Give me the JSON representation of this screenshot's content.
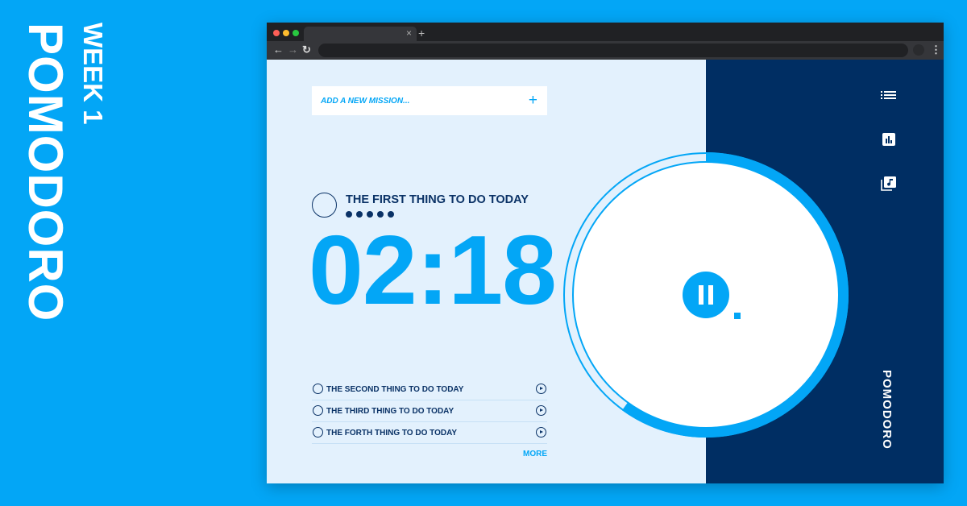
{
  "poster": {
    "week": "WEEK 1",
    "title": "POMODORO",
    "background": "#03a6f6"
  },
  "browser": {
    "tab_close": "×",
    "new_tab": "+",
    "back": "←",
    "forward": "→",
    "reload": "↻",
    "menu": "⋮"
  },
  "app": {
    "add_placeholder": "ADD A NEW MISSION...",
    "add_icon": "+",
    "current": {
      "title": "THE FIRST THING TO DO TODAY",
      "pomodoros": 5
    },
    "timer": "02:18",
    "progress": 0.6,
    "tasks": [
      {
        "label": "THE SECOND THING TO DO TODAY"
      },
      {
        "label": "THE THIRD THING TO DO TODAY"
      },
      {
        "label": "THE FORTH THING TO DO TODAY"
      }
    ],
    "more": "MORE",
    "sidebar_icons": [
      "list-icon",
      "chart-icon",
      "music-library-icon"
    ],
    "brand": "POMODORO",
    "colors": {
      "accent": "#03a6f6",
      "navy": "#002e63",
      "panel": "#e3f1fd"
    }
  }
}
